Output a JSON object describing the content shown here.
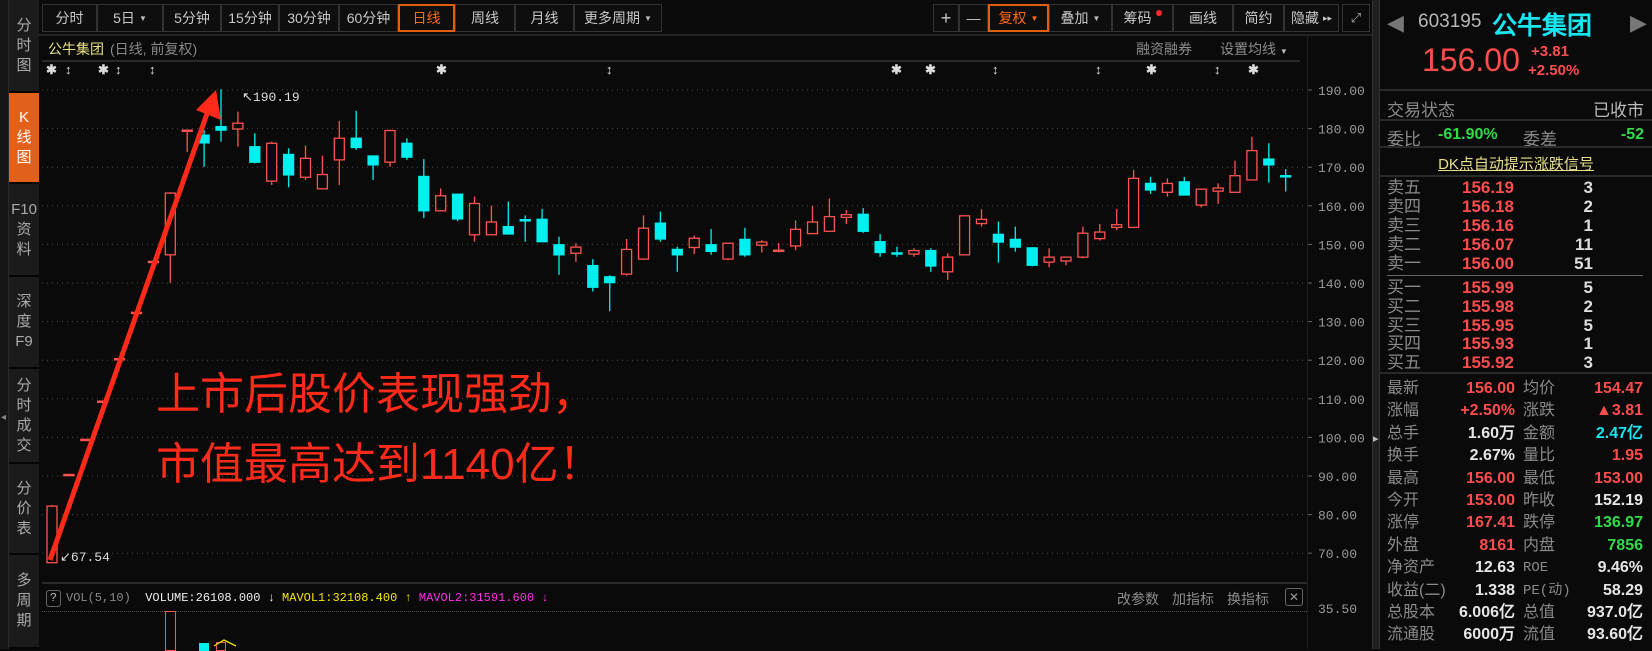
{
  "sidebar": [
    {
      "label": "分\n时\n图"
    },
    {
      "label": "K\n线\n图",
      "active": true
    },
    {
      "label": "F10\n资\n料"
    },
    {
      "label": "深\n度\nF9"
    },
    {
      "label": "分\n时\n成\n交"
    },
    {
      "label": "分\n价\n表"
    },
    {
      "label": "多\n周\n期"
    }
  ],
  "toolbar": {
    "periods": [
      "分时",
      "5日",
      "5分钟",
      "15分钟",
      "30分钟",
      "60分钟",
      "日线",
      "周线",
      "月线",
      "更多周期"
    ],
    "active_period": "日线",
    "tools": [
      "+",
      "—",
      "复权",
      "叠加",
      "筹码",
      "画线",
      "简约",
      "隐藏"
    ],
    "hide_icon": "▸▸",
    "expand_icon": "⤢"
  },
  "chart_header": {
    "stock_name": "公牛集团",
    "mode": "(日线, 前复权)",
    "margin_link": "融资融券",
    "ma_setting": "设置均线"
  },
  "markers": [
    "✱",
    "↕",
    "✱",
    "↕",
    "↕",
    "✱",
    "↕",
    "✱",
    "✱",
    "↕",
    "↕",
    "✱",
    "↕",
    "✱"
  ],
  "annotation": {
    "line1": "上市后股价表现强劲，",
    "line2": "市值最高达到1140亿！"
  },
  "colors": {
    "up": "#ff5252",
    "down": "#00f0f0",
    "accent": "#e0600e",
    "annotation": "#ff2a1a"
  },
  "chart_data": {
    "type": "candlestick",
    "ylim": [
      70,
      190
    ],
    "y_ticks": [
      "190.00",
      "180.00",
      "170.00",
      "160.00",
      "150.00",
      "140.00",
      "130.00",
      "120.00",
      "110.00",
      "100.00",
      "90.00",
      "80.00",
      "70.00"
    ],
    "y_tick_values": [
      190,
      180,
      170,
      160,
      150,
      140,
      130,
      120,
      110,
      100,
      90,
      80,
      70
    ],
    "high_label": "190.19",
    "low_label": "67.54",
    "ohlc": [
      [
        67.54,
        82.5,
        67.54,
        82.2
      ],
      [
        90.4,
        90.4,
        90.4,
        90.4
      ],
      [
        99.5,
        99.5,
        99.5,
        99.5
      ],
      [
        109.4,
        109.4,
        109.4,
        109.4
      ],
      [
        120.4,
        120.4,
        120.4,
        120.4
      ],
      [
        132.4,
        132.4,
        132.4,
        132.4
      ],
      [
        145.6,
        145.6,
        145.6,
        145.6
      ],
      [
        147.3,
        163.5,
        140.0,
        163.3
      ],
      [
        179.6,
        179.6,
        173.9,
        179.6
      ],
      [
        178.3,
        179.6,
        170.1,
        176.3
      ],
      [
        180.5,
        190.19,
        176.6,
        179.6
      ],
      [
        179.9,
        184.4,
        175.3,
        181.4
      ],
      [
        175.3,
        178.8,
        171.0,
        171.3
      ],
      [
        166.4,
        176.6,
        165.4,
        176.2
      ],
      [
        173.3,
        174.9,
        164.8,
        168.0
      ],
      [
        167.4,
        175.6,
        166.7,
        172.3
      ],
      [
        164.4,
        173.0,
        164.4,
        168.1
      ],
      [
        171.9,
        182.0,
        165.4,
        177.5
      ],
      [
        177.5,
        184.6,
        174.5,
        175.1
      ],
      [
        172.9,
        172.9,
        166.7,
        170.6
      ],
      [
        171.3,
        179.7,
        170.1,
        179.5
      ],
      [
        176.2,
        177.5,
        171.9,
        172.6
      ],
      [
        167.6,
        172.1,
        156.8,
        158.7
      ],
      [
        158.7,
        164.5,
        158.7,
        162.6
      ],
      [
        163.0,
        163.0,
        156.0,
        156.6
      ],
      [
        152.5,
        162.4,
        150.7,
        160.6
      ],
      [
        152.5,
        160.0,
        152.5,
        155.8
      ],
      [
        154.6,
        161.1,
        152.7,
        152.7
      ],
      [
        156.4,
        157.5,
        150.7,
        156.2
      ],
      [
        156.5,
        159.2,
        150.7,
        150.7
      ],
      [
        149.9,
        152.0,
        142.1,
        147.3
      ],
      [
        147.7,
        150.3,
        145.5,
        149.3
      ],
      [
        144.5,
        146.2,
        137.8,
        138.9
      ],
      [
        141.6,
        142.0,
        132.7,
        140.1
      ],
      [
        142.3,
        151.4,
        141.9,
        148.7
      ],
      [
        146.2,
        157.5,
        146.0,
        154.2
      ],
      [
        155.5,
        158.5,
        150.7,
        151.4
      ],
      [
        148.7,
        149.4,
        142.9,
        147.3
      ],
      [
        149.2,
        152.3,
        147.5,
        151.6
      ],
      [
        149.9,
        154.0,
        147.3,
        148.2
      ],
      [
        146.2,
        150.3,
        145.9,
        150.3
      ],
      [
        151.3,
        154.3,
        146.8,
        147.3
      ],
      [
        149.8,
        151.1,
        147.9,
        150.6
      ],
      [
        148.5,
        150.3,
        147.9,
        148.5
      ],
      [
        149.6,
        156.2,
        148.5,
        153.9
      ],
      [
        152.8,
        160.0,
        152.8,
        155.8
      ],
      [
        153.4,
        161.9,
        153.4,
        157.2
      ],
      [
        157.0,
        158.9,
        155.3,
        157.7
      ],
      [
        157.8,
        159.4,
        153.0,
        153.4
      ],
      [
        150.7,
        152.7,
        146.8,
        147.9
      ],
      [
        147.8,
        149.4,
        146.8,
        147.6
      ],
      [
        147.5,
        149.0,
        146.8,
        148.4
      ],
      [
        148.4,
        149.0,
        142.9,
        144.4
      ],
      [
        142.9,
        147.7,
        140.8,
        146.7
      ],
      [
        147.3,
        157.4,
        147.3,
        157.4
      ],
      [
        155.4,
        159.1,
        154.6,
        156.5
      ],
      [
        152.6,
        155.9,
        145.3,
        150.6
      ],
      [
        151.3,
        154.6,
        148.1,
        149.3
      ],
      [
        149.1,
        149.3,
        144.3,
        144.6
      ],
      [
        145.4,
        149.0,
        144.1,
        146.7
      ],
      [
        145.7,
        146.7,
        144.6,
        146.7
      ],
      [
        146.7,
        154.6,
        146.4,
        152.9
      ],
      [
        151.5,
        155.3,
        151.0,
        153.2
      ],
      [
        154.4,
        159.2,
        153.7,
        155.1
      ],
      [
        154.4,
        169.3,
        154.4,
        167.1
      ],
      [
        165.8,
        167.5,
        163.1,
        164.1
      ],
      [
        163.5,
        167.1,
        162.4,
        165.8
      ],
      [
        166.2,
        167.5,
        162.8,
        162.8
      ],
      [
        160.2,
        164.3,
        159.6,
        164.3
      ],
      [
        163.8,
        165.8,
        160.5,
        164.6
      ],
      [
        163.5,
        171.7,
        163.5,
        167.8
      ],
      [
        166.7,
        177.9,
        166.7,
        174.3
      ],
      [
        172.1,
        176.2,
        166.0,
        170.6
      ],
      [
        167.8,
        169.5,
        163.7,
        167.6
      ]
    ]
  },
  "volume": {
    "help": "?",
    "name": "VOL(5,10)",
    "volume": "VOLUME:26108.000",
    "volume_arrow": "↓",
    "mavol1": "MAVOL1:32108.400",
    "mavol1_arrow": "↑",
    "mavol2": "MAVOL2:31591.600",
    "mavol2_arrow": "↓",
    "axis_label": "35.50",
    "tools": [
      "改参数",
      "加指标",
      "换指标"
    ],
    "close_icon": "✕"
  },
  "quote": {
    "code": "603195",
    "name": "公牛集团",
    "price": "156.00",
    "change": "+3.81",
    "change_pct": "+2.50%",
    "status_label": "交易状态",
    "status_value": "已收市",
    "weibi_label": "委比",
    "weibi_value": "-61.90%",
    "weicha_label": "委差",
    "weicha_value": "-52",
    "dk_link": "DK点自动提示涨跌信号",
    "asks": [
      {
        "label": "卖五",
        "price": "156.19",
        "vol": "3"
      },
      {
        "label": "卖四",
        "price": "156.18",
        "vol": "2"
      },
      {
        "label": "卖三",
        "price": "156.16",
        "vol": "1"
      },
      {
        "label": "卖二",
        "price": "156.07",
        "vol": "11"
      },
      {
        "label": "卖一",
        "price": "156.00",
        "vol": "51"
      }
    ],
    "bids": [
      {
        "label": "买一",
        "price": "155.99",
        "vol": "5"
      },
      {
        "label": "买二",
        "price": "155.98",
        "vol": "2"
      },
      {
        "label": "买三",
        "price": "155.95",
        "vol": "5"
      },
      {
        "label": "买四",
        "price": "155.93",
        "vol": "1"
      },
      {
        "label": "买五",
        "price": "155.92",
        "vol": "3"
      }
    ],
    "stats": [
      {
        "l1": "最新",
        "v1": "156.00",
        "c1": "red",
        "l2": "均价",
        "v2": "154.47",
        "c2": "red"
      },
      {
        "l1": "涨幅",
        "v1": "+2.50%",
        "c1": "red",
        "l2": "涨跌",
        "v2": "▲3.81",
        "c2": "red"
      },
      {
        "l1": "总手",
        "v1": "1.60万",
        "c1": "wht",
        "l2": "金额",
        "v2": "2.47亿",
        "c2": "cyn"
      },
      {
        "l1": "换手",
        "v1": "2.67%",
        "c1": "wht",
        "l2": "量比",
        "v2": "1.95",
        "c2": "red"
      },
      {
        "l1": "最高",
        "v1": "156.00",
        "c1": "red",
        "l2": "最低",
        "v2": "153.00",
        "c2": "red"
      },
      {
        "l1": "今开",
        "v1": "153.00",
        "c1": "red",
        "l2": "昨收",
        "v2": "152.19",
        "c2": "wht"
      },
      {
        "l1": "涨停",
        "v1": "167.41",
        "c1": "red",
        "l2": "跌停",
        "v2": "136.97",
        "c2": "grn"
      },
      {
        "l1": "外盘",
        "v1": "8161",
        "c1": "red",
        "l2": "内盘",
        "v2": "7856",
        "c2": "grn"
      },
      {
        "l1": "净资产",
        "v1": "12.63",
        "c1": "wht",
        "l2": "ROE",
        "v2": "9.46%",
        "c2": "wht"
      },
      {
        "l1": "收益(二)",
        "v1": "1.338",
        "c1": "wht",
        "l2": "PE(动)",
        "v2": "58.29",
        "c2": "wht"
      },
      {
        "l1": "总股本",
        "v1": "6.006亿",
        "c1": "wht",
        "l2": "总值",
        "v2": "937.0亿",
        "c2": "wht"
      },
      {
        "l1": "流通股",
        "v1": "6000万",
        "c1": "wht",
        "l2": "流值",
        "v2": "93.60亿",
        "c2": "wht"
      }
    ]
  }
}
